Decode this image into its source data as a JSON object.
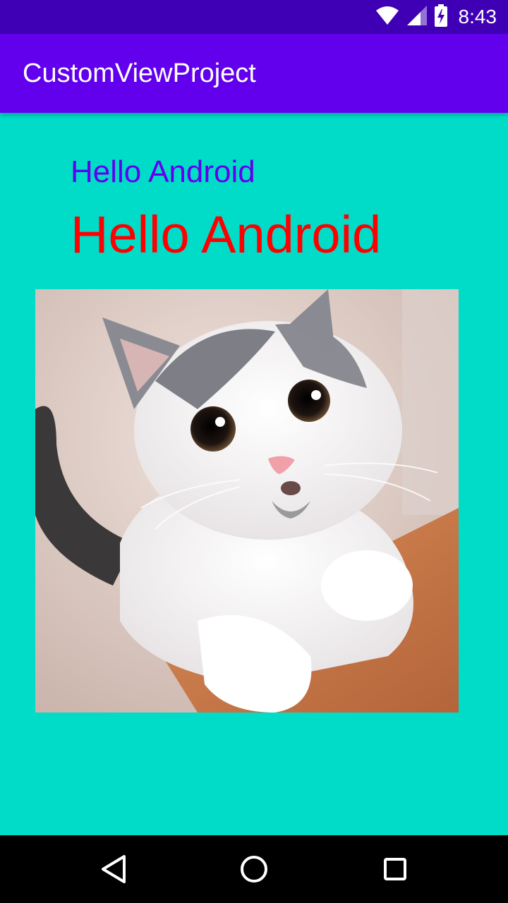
{
  "status_bar": {
    "time": "8:43",
    "icons": [
      "wifi-icon",
      "cell-signal-icon",
      "battery-charging-icon"
    ]
  },
  "app_bar": {
    "title": "CustomViewProject"
  },
  "main": {
    "text_small": "Hello Android",
    "text_small_color": "#6200EE",
    "text_large": "Hello Android",
    "text_large_color": "#FF0000",
    "image_subject": "kitten"
  },
  "nav_bar": {
    "icons": [
      "back-icon",
      "home-icon",
      "recents-icon"
    ]
  },
  "colors": {
    "status_bar": "#3F00B5",
    "app_bar": "#6200EE",
    "background": "#00DCC8",
    "nav_bar": "#000000"
  }
}
